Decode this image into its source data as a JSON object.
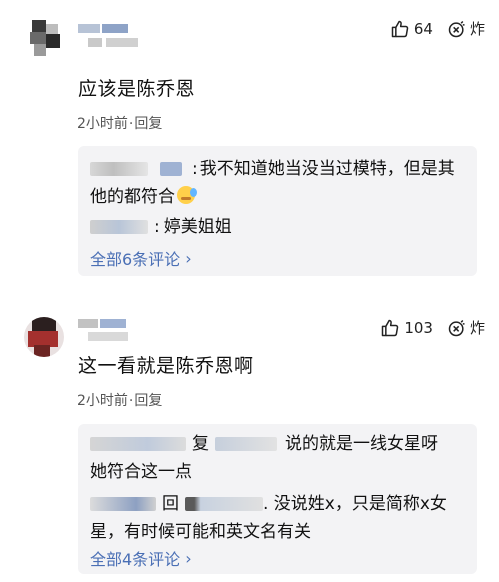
{
  "comments": [
    {
      "text": "应该是陈乔恩",
      "time": "2小时前",
      "reply_label": "回复",
      "likes": "64",
      "boom_label": "炸",
      "replies": [
        {
          "prefix": ":",
          "text": "我不知道她当没当过模特，但是其他的都符合"
        },
        {
          "prefix": ":",
          "text": "婷美姐姐"
        }
      ],
      "view_all": "全部6条评论"
    },
    {
      "text": "这一看就是陈乔恩啊",
      "time": "2小时前",
      "reply_label": "回复",
      "likes": "103",
      "boom_label": "炸",
      "replies": [
        {
          "a": "复",
          "b": "说的就是一线女星呀",
          "c": "她符合这一点"
        },
        {
          "a": "回",
          "b": ". 没说姓x，只是简称x女星，有时候可能和英文名有关"
        }
      ],
      "view_all": "全部4条评论"
    }
  ],
  "icons": {
    "like": "thumbs-up-icon",
    "boom": "bomb-icon",
    "more": "chevron-right-icon"
  },
  "colors": {
    "link": "#4a6fb5",
    "reply_bg": "#f3f3f5"
  }
}
